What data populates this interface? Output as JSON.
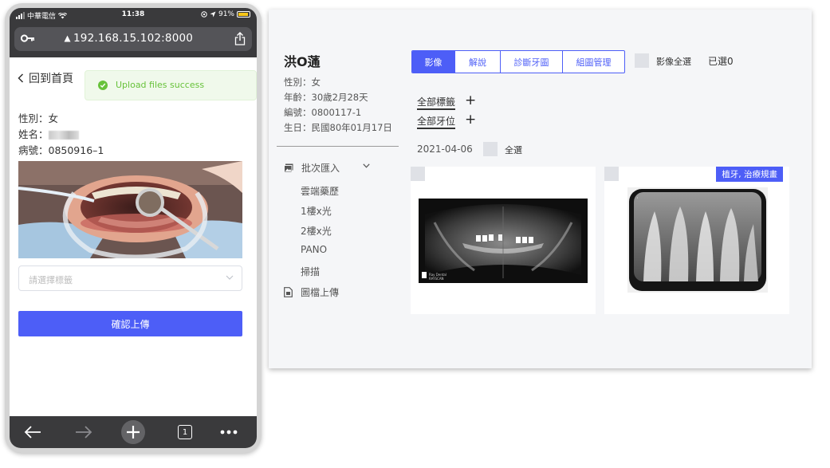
{
  "phone": {
    "status": {
      "carrier": "中華電信",
      "time": "11:38",
      "battery": "91%"
    },
    "url": "192.168.15.102:8000",
    "back_label": "回到首頁",
    "toast": "Upload files success",
    "patient": {
      "gender": "性別：女",
      "name_label": "姓名：",
      "record": "病號：0850916–1"
    },
    "select_placeholder": "請選擇標籤",
    "confirm_label": "確認上傳",
    "tab_count": "1"
  },
  "desktop": {
    "patient": {
      "name": "洪O蓪",
      "gender": "性別：女",
      "age": "年齡：30歲2月28天",
      "number": "編號：0800117-1",
      "birthday": "生日：民國80年01月17日"
    },
    "sidebar": {
      "batch_import": "批次匯入",
      "items": [
        "雲端藥歷",
        "1樓x光",
        "2樓x光",
        "PANO",
        "掃描"
      ],
      "image_upload": "圖檔上傳"
    },
    "tabs": [
      "影像",
      "解說",
      "診斷牙圖",
      "組圖管理"
    ],
    "select_all_images": "影像全選",
    "selected_count": "已選0",
    "filters": {
      "tags": "全部標籤",
      "teeth": "全部牙位"
    },
    "date": "2021-04-06",
    "select_all": "全選",
    "cards": [
      {
        "tag": "",
        "xray_caption": "RAYSCAN"
      },
      {
        "tag": "植牙, 治療規畫"
      }
    ]
  },
  "colors": {
    "accent": "#4d5ef7",
    "success": "#67c23a",
    "chrome": "#3a3a3c"
  }
}
